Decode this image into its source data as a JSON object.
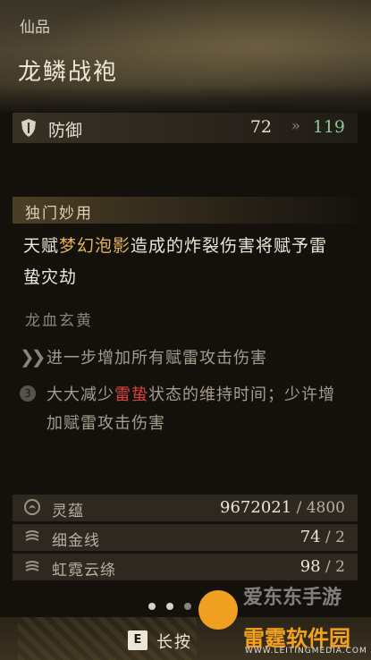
{
  "item": {
    "rarity": "仙品",
    "name": "龙鳞战袍",
    "stat": {
      "icon": "shield-icon",
      "label": "防御",
      "old_value": "72",
      "arrow": "»",
      "new_value": "119"
    }
  },
  "unique_effect": {
    "title": "独门妙用",
    "desc_prefix": "天赋",
    "desc_highlight": "梦幻泡影",
    "desc_suffix": "造成的炸裂伤害将赋予雷蛰灾劫"
  },
  "set": {
    "title": "龙血玄黄",
    "effect1": {
      "icon": "double-chevron-icon",
      "text": "进一步增加所有赋雷攻击伤害"
    },
    "effect2": {
      "badge": "3",
      "text_prefix": "大大减少",
      "text_highlight": "雷蛰",
      "text_suffix": "状态的维持时间；少许增加赋雷攻击伤害"
    }
  },
  "materials": [
    {
      "icon": "lingyun-icon",
      "name": "灵蕴",
      "have": "9672021",
      "sep": " / ",
      "need": "4800"
    },
    {
      "icon": "silk-thread-icon",
      "name": "细金线",
      "have": "74",
      "sep": " / ",
      "need": "2"
    },
    {
      "icon": "cloud-silk-icon",
      "name": "虹霓云绦",
      "have": "98",
      "sep": " / ",
      "need": "2"
    }
  ],
  "footer": {
    "key": "E",
    "label": "长按"
  },
  "watermark": {
    "line1": "爱东东手游",
    "line2": "雷霆软件园",
    "line3": "WWW.LEITINGMEDIA.COM"
  },
  "colors": {
    "highlight_gold": "#e0b25a",
    "highlight_red": "#d8423a",
    "increase_green": "#8fc59a"
  }
}
